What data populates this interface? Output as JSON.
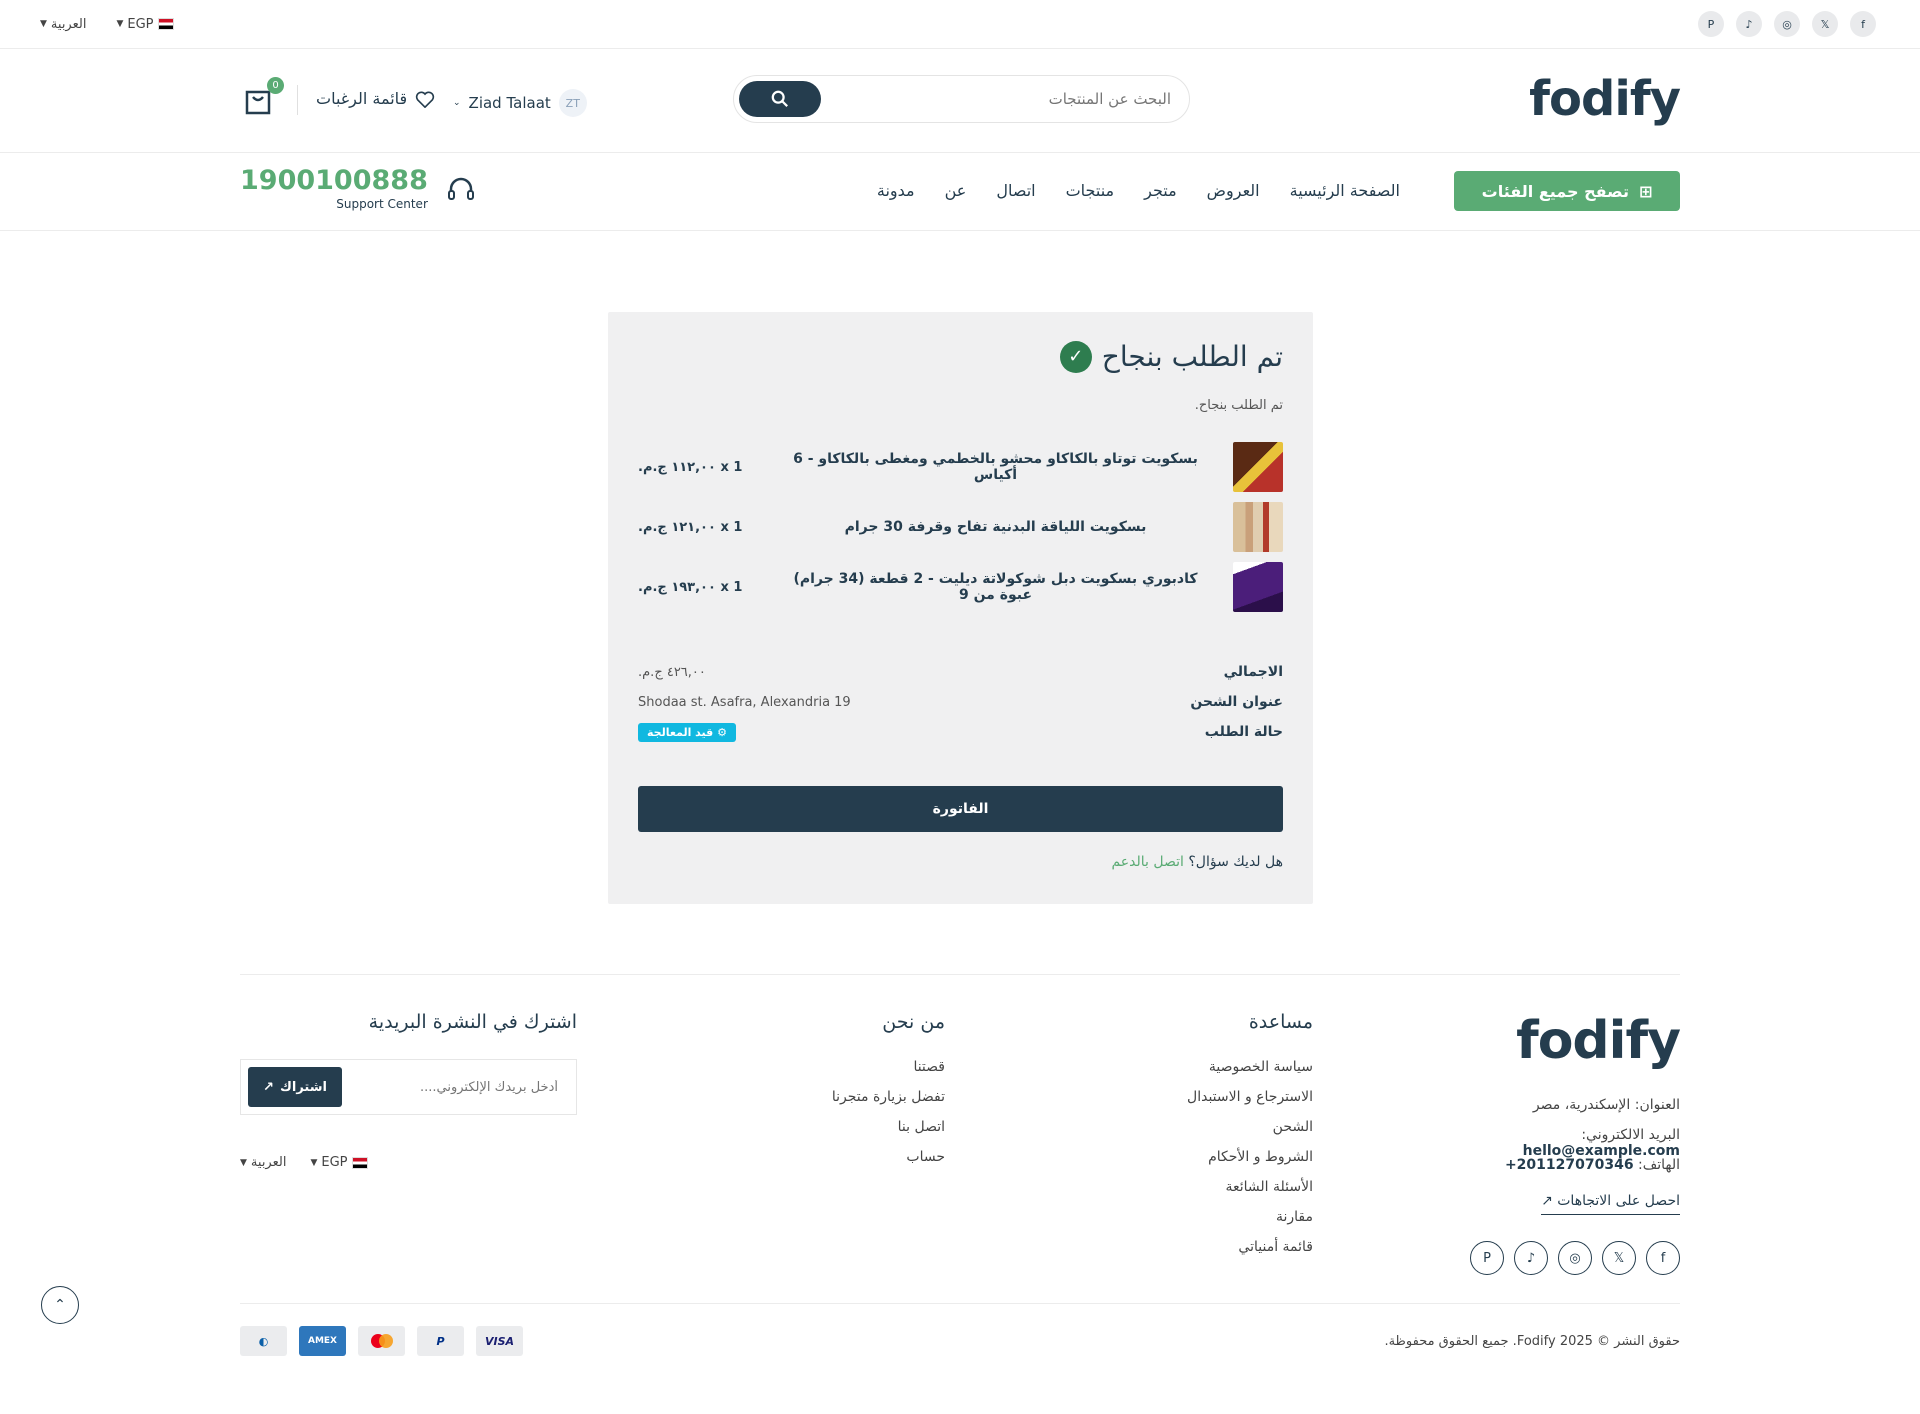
{
  "topbar": {
    "language": "العربية",
    "currency": "EGP",
    "social_icons": [
      "facebook-icon",
      "x-icon",
      "instagram-icon",
      "tiktok-icon",
      "pinterest-icon"
    ]
  },
  "header": {
    "logo": "fodify",
    "search_placeholder": "البحث عن المنتجات",
    "user_initials": "ZT",
    "user_name": "Ziad Talaat",
    "wishlist_label": "قائمة الرغبات",
    "cart_count": "0"
  },
  "nav": {
    "browse_label": "تصفح جميع الفئات",
    "menu": [
      "الصفحة الرئيسية",
      "العروض",
      "متجر",
      "منتجات",
      "اتصال",
      "عن",
      "مدونة"
    ],
    "support_number": "1900100888",
    "support_label": "Support Center"
  },
  "order": {
    "title": "تم الطلب بنجاح",
    "subtitle": "تم الطلب بنجاح.",
    "items": [
      {
        "name": "بسكويت توتاو بالكاكاو محشو بالخطمي ومغطى بالكاكاو - 6 أكياس",
        "qty": "x 1",
        "price": "١١٢,٠٠ ج.م."
      },
      {
        "name": "بسكويت اللياقة البدنية تفاح وقرفة 30 جرام",
        "qty": "x 1",
        "price": "١٢١,٠٠ ج.م."
      },
      {
        "name": "كادبوري بسكويت دبل شوكولاتة ديليت - 2 قطعة (34 جرام) عبوة من 9",
        "qty": "x 1",
        "price": "١٩٣,٠٠ ج.م."
      }
    ],
    "total_label": "الاجمالي",
    "total_value": "٤٢٦,٠٠ ج.م.",
    "address_label": "عنوان الشحن",
    "address_value": "Shodaa st. Asafra, Alexandria 19",
    "status_label": "حالة الطلب",
    "status_value": "قيد المعالجة",
    "invoice_button": "الفاتورة",
    "help_question": "هل لديك سؤال؟",
    "help_link": "اتصل بالدعم"
  },
  "footer": {
    "logo": "fodify",
    "address": "العنوان: الإسكندرية، مصر",
    "email_label": "البريد الالكتروني:",
    "email": "hello@example.com",
    "phone_label": "الهاتف:",
    "phone": "+201127070346",
    "directions": "احصل على الاتجاهات",
    "help_title": "مساعدة",
    "help_links": [
      "سياسة الخصوصية",
      "الاسترجاع و الاستبدال",
      "الشحن",
      "الشروط و الأحكام",
      "الأسئلة الشائعة",
      "مقارنة",
      "قائمة أمنياتي"
    ],
    "about_title": "من نحن",
    "about_links": [
      "قصتنا",
      "تفضل بزيارة متجرنا",
      "اتصل بنا",
      "حساب"
    ],
    "newsletter_title": "اشترك في النشرة البريدية",
    "newsletter_placeholder": "أدخل بريدك الإلكتروني....",
    "subscribe_label": "اشتراك",
    "currency": "EGP",
    "language": "العربية",
    "copyright": "حقوق النشر © Fodify 2025. جميع الحقوق محفوظة.",
    "payments": [
      "VISA",
      "PayPal",
      "Mastercard",
      "AMEX",
      "Diners Club"
    ]
  },
  "colors": {
    "primary": "#253d4e",
    "accent": "#5aab74",
    "status": "#10b8e0",
    "success": "#2e7d4f"
  }
}
